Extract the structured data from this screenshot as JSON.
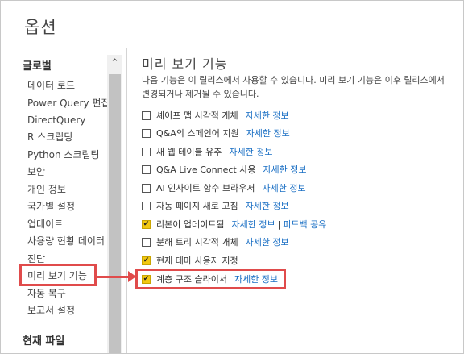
{
  "window": {
    "title": "옵션"
  },
  "sidebar": {
    "global_header": "글로벌",
    "items": [
      {
        "label": "데이터 로드"
      },
      {
        "label": "Power Query 편집기"
      },
      {
        "label": "DirectQuery"
      },
      {
        "label": "R 스크립팅"
      },
      {
        "label": "Python 스크립팅"
      },
      {
        "label": "보안"
      },
      {
        "label": "개인 정보"
      },
      {
        "label": "국가별 설정"
      },
      {
        "label": "업데이트"
      },
      {
        "label": "사용량 현황 데이터"
      },
      {
        "label": "진단"
      },
      {
        "label": "미리 보기 기능"
      },
      {
        "label": "자동 복구"
      },
      {
        "label": "보고서 설정"
      }
    ],
    "current_file_header": "현재 파일",
    "scroll_up_icon": "chevron-up-icon"
  },
  "main": {
    "title": "미리 보기 기능",
    "description": "다음 기능은 이 릴리스에서 사용할 수 있습니다. 미리 보기 기능은 이후 릴리스에서 변경되거나 제거될 수 있습니다.",
    "features": [
      {
        "label": "셰이프 맵 시각적 개체",
        "checked": false,
        "link": "자세한 정보"
      },
      {
        "label": "Q&A의 스페인어 지원",
        "checked": false,
        "link": "자세한 정보"
      },
      {
        "label": "새 웹 테이블 유추",
        "checked": false,
        "link": "자세한 정보"
      },
      {
        "label": "Q&A Live Connect 사용",
        "checked": false,
        "link": "자세한 정보"
      },
      {
        "label": "AI 인사이트 함수 브라우저",
        "checked": false,
        "link": "자세한 정보"
      },
      {
        "label": "자동 페이지 새로 고침",
        "checked": false,
        "link": "자세한 정보"
      },
      {
        "label": "리본이 업데이트됨",
        "checked": true,
        "link": "자세한 정보",
        "extra_link": "피드백 공유"
      },
      {
        "label": "분해 트리 시각적 개체",
        "checked": false,
        "link": "자세한 정보"
      },
      {
        "label": "현재 테마 사용자 지정",
        "checked": true,
        "link": ""
      },
      {
        "label": "계층 구조 슬라이서",
        "checked": true,
        "link": "자세한 정보"
      }
    ]
  },
  "colors": {
    "accent_highlight": "#e04b4b",
    "checkbox_checked": "#f2c811",
    "link": "#1a6fc4"
  }
}
